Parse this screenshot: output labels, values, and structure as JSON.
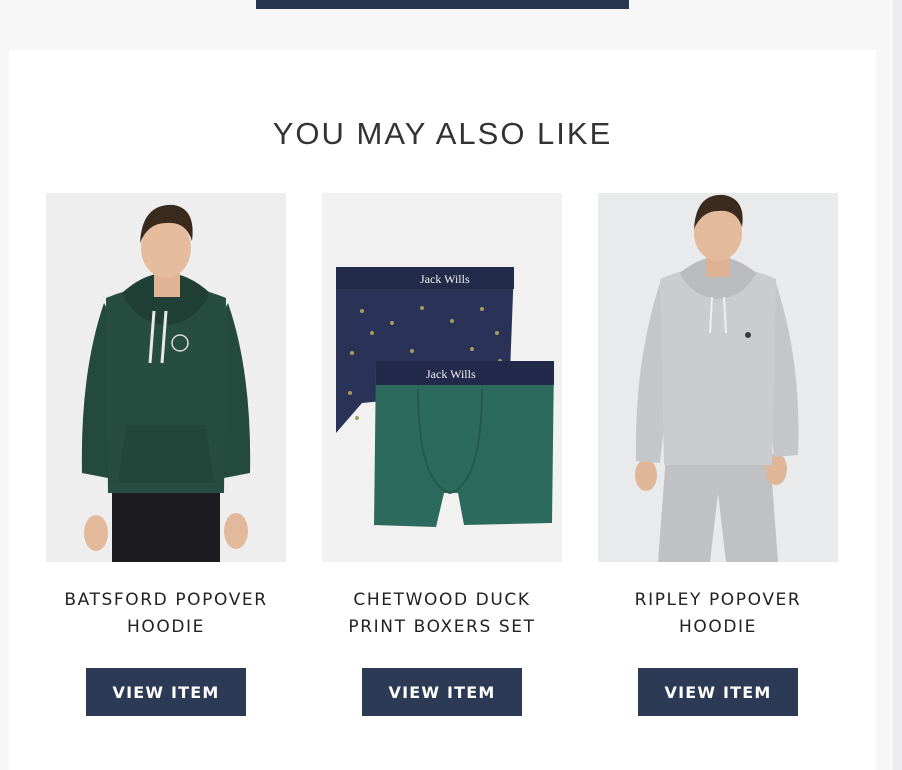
{
  "section": {
    "heading": "YOU MAY ALSO LIKE"
  },
  "products": [
    {
      "name_line1": "BATSFORD POPOVER",
      "name_line2": "HOODIE",
      "button_label": "VIEW ITEM"
    },
    {
      "name_line1": "CHETWOOD DUCK",
      "name_line2": "PRINT BOXERS SET",
      "button_label": "VIEW ITEM"
    },
    {
      "name_line1": "RIPLEY POPOVER",
      "name_line2": "HOODIE",
      "button_label": "VIEW ITEM"
    }
  ],
  "waistband_text": "Jack Wills",
  "colors": {
    "button": "#2c3a55",
    "green_hoodie": "#254b3f",
    "grey_hoodie": "#c9cbcd",
    "navy_boxer": "#2a3357",
    "green_boxer": "#2b6a5c"
  }
}
